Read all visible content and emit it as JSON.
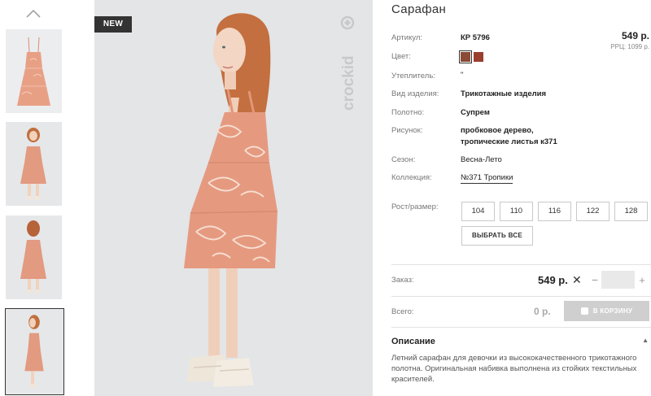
{
  "product": {
    "title": "Сарафан",
    "badge": "NEW",
    "brand_watermark": "crockid",
    "price": "549 р.",
    "rrc": "РРЦ: 1099 р.",
    "details": [
      {
        "label": "Артикул:",
        "value": "КР 5796"
      },
      {
        "label": "Цвет:",
        "value": ""
      },
      {
        "label": "Утеплитель:",
        "value": "\""
      },
      {
        "label": "Вид изделия:",
        "value": "Трикотажные изделия"
      },
      {
        "label": "Полотно:",
        "value": "Супрем"
      },
      {
        "label": "Рисунок:",
        "value": "пробковое дерево,\nтропические листья к371"
      },
      {
        "label": "Сезон:",
        "value": "Весна-Лето"
      },
      {
        "label": "Коллекция:",
        "value": "№371 Тропики"
      }
    ],
    "colors": [
      "#8a4a36",
      "#9a3e2e"
    ]
  },
  "sizes": {
    "label": "Рост/размер:",
    "options": [
      "104",
      "110",
      "116",
      "122",
      "128"
    ],
    "select_all": "ВЫБРАТЬ ВСЕ"
  },
  "order": {
    "label": "Заказ:",
    "price": "549 р.",
    "times": "✕",
    "minus": "−",
    "plus": "+",
    "quantity": ""
  },
  "total": {
    "label": "Всего:",
    "value": "0 р.",
    "cart_button": "В КОРЗИНУ"
  },
  "description": {
    "title": "Описание",
    "toggle": "▲",
    "text": "Летний сарафан для девочки из высококачественного трикотажного полотна. Оригинальная набивка выполнена из стойких текстильных красителей."
  },
  "icons": {
    "thumbs_up": "chevron-up-icon",
    "cart": "cart-icon"
  }
}
